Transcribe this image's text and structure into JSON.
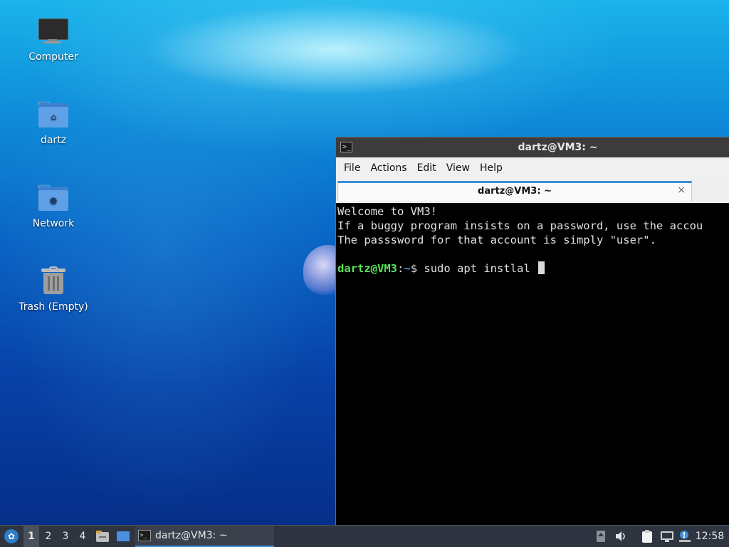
{
  "desktop": {
    "icons": [
      {
        "label": "Computer",
        "icon": "computer-icon"
      },
      {
        "label": "dartz",
        "icon": "home-folder-icon"
      },
      {
        "label": "Network",
        "icon": "network-folder-icon"
      },
      {
        "label": "Trash (Empty)",
        "icon": "trash-icon"
      }
    ]
  },
  "terminal": {
    "title": "dartz@VM3: ~",
    "menu": [
      "File",
      "Actions",
      "Edit",
      "View",
      "Help"
    ],
    "tab_label": "dartz@VM3: ~",
    "tab_close": "×",
    "lines": [
      "Welcome to VM3!",
      "If a buggy program insists on a password, use the accou",
      "The passsword for that account is simply \"user\"."
    ],
    "prompt_user": "dartz@VM3",
    "prompt_sep": ":",
    "prompt_path": "~",
    "prompt_symbol": "$ ",
    "command": "sudo apt instlal",
    "colors": {
      "user": "#59e35a",
      "path": "#5b8ff0",
      "background": "#000000",
      "accent": "#3d8fd7"
    }
  },
  "taskbar": {
    "workspaces": [
      "1",
      "2",
      "3",
      "4"
    ],
    "active_workspace": "1",
    "task_label": "dartz@VM3: ~",
    "clock": "12:58",
    "tray_icons": [
      "up-arrow-icon",
      "volume-icon",
      "clipboard-icon",
      "network-icon",
      "update-icon"
    ]
  }
}
